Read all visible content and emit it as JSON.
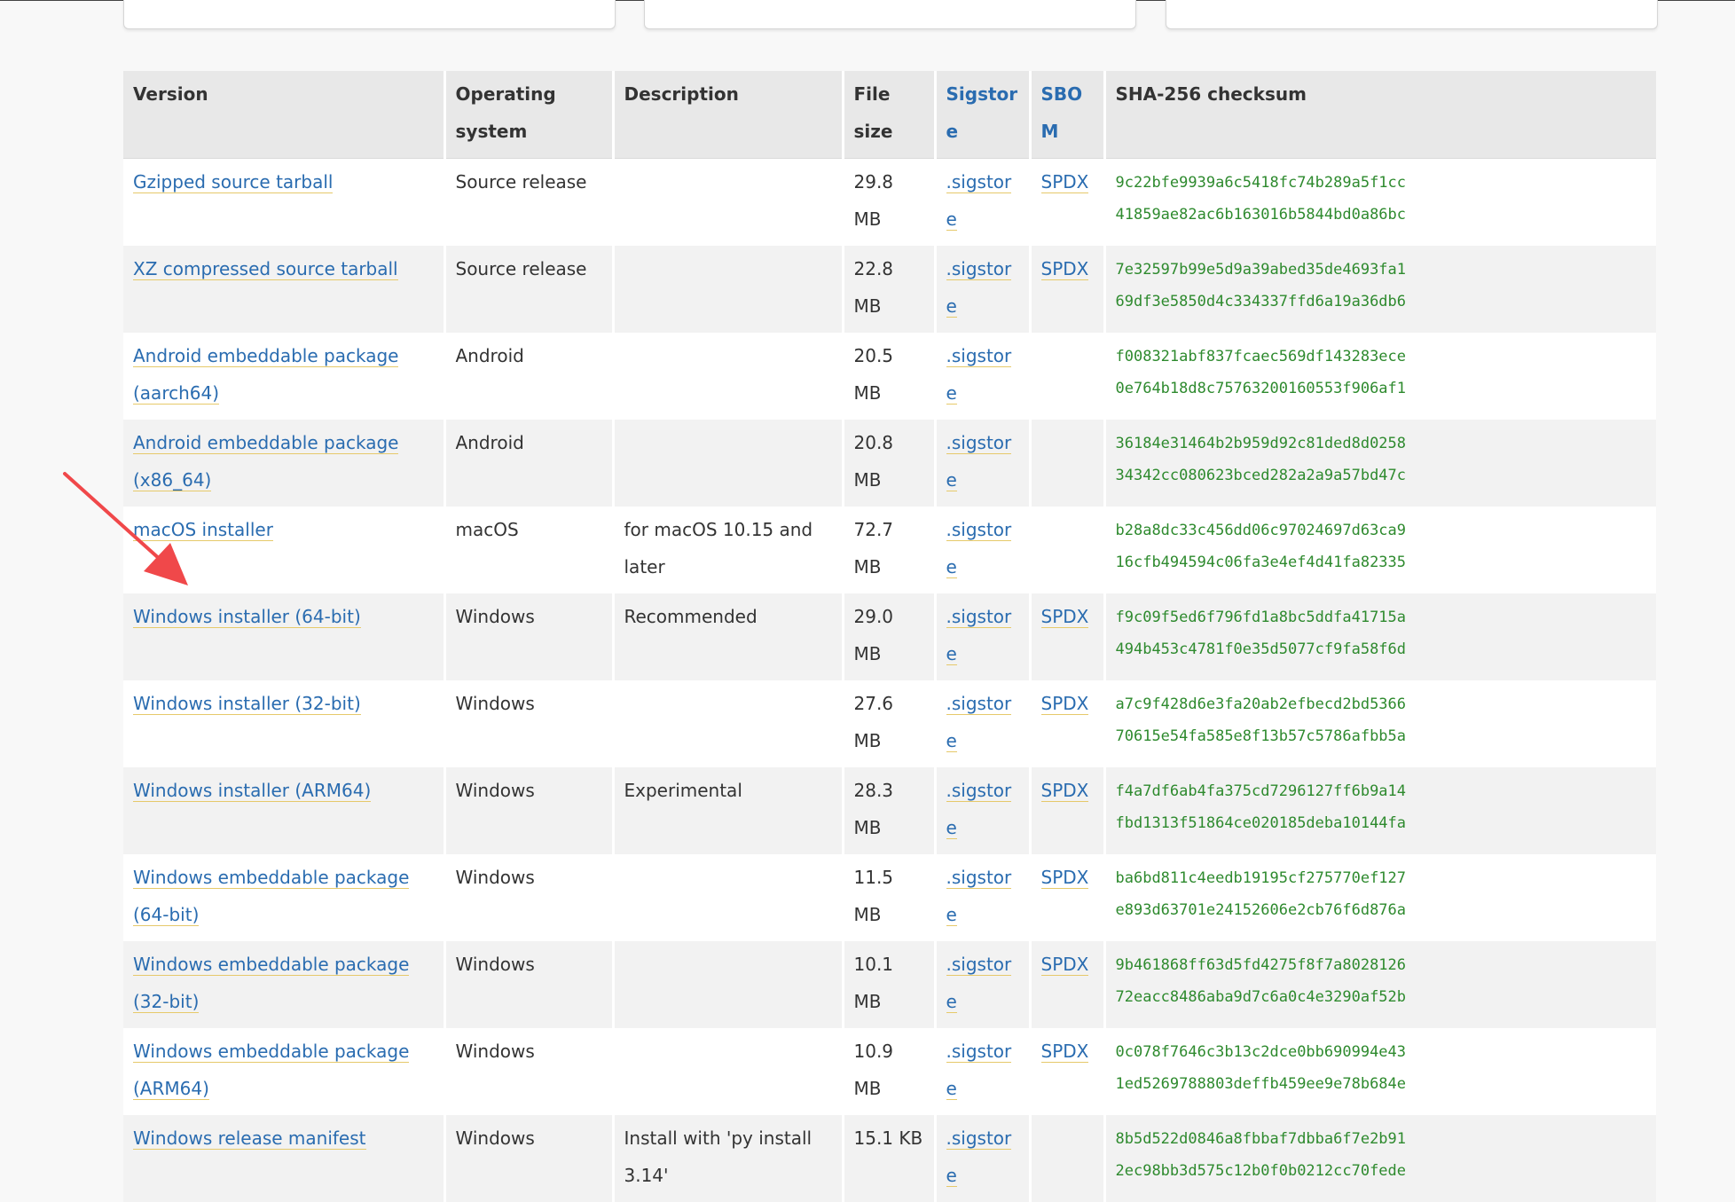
{
  "colors": {
    "link": "#2a6cb0",
    "link_underline": "#e6c96a",
    "checksum": "#2e8a2e",
    "arrow": "#f0484a",
    "header_bg": "#e8e8e8"
  },
  "table": {
    "headers": {
      "version": "Version",
      "os": "Operating system",
      "description": "Description",
      "size": "File size",
      "sigstore": "Sigstore",
      "sbom": "SBOM",
      "sha": "SHA-256 checksum"
    },
    "rows": [
      {
        "version": "Gzipped source tarball",
        "os": "Source release",
        "description": "",
        "size": "29.8 MB",
        "sigstore": ".sigstore",
        "sbom": "SPDX",
        "sha1": "9c22bfe9939a6c5418fc74b289a5f1cc",
        "sha2": "41859ae82ac6b163016b5844bd0a86bc"
      },
      {
        "version": "XZ compressed source tarball",
        "os": "Source release",
        "description": "",
        "size": "22.8 MB",
        "sigstore": ".sigstore",
        "sbom": "SPDX",
        "sha1": "7e32597b99e5d9a39abed35de4693fa1",
        "sha2": "69df3e5850d4c334337ffd6a19a36db6"
      },
      {
        "version": "Android embeddable package (aarch64)",
        "os": "Android",
        "description": "",
        "size": "20.5 MB",
        "sigstore": ".sigstore",
        "sbom": "",
        "sha1": "f008321abf837fcaec569df143283ece",
        "sha2": "0e764b18d8c75763200160553f906af1"
      },
      {
        "version": "Android embeddable package (x86_64)",
        "os": "Android",
        "description": "",
        "size": "20.8 MB",
        "sigstore": ".sigstore",
        "sbom": "",
        "sha1": "36184e31464b2b959d92c81ded8d0258",
        "sha2": "34342cc080623bced282a2a9a57bd47c"
      },
      {
        "version": "macOS installer",
        "os": "macOS",
        "description": "for macOS 10.15 and later",
        "size": "72.7 MB",
        "sigstore": ".sigstore",
        "sbom": "",
        "sha1": "b28a8dc33c456dd06c97024697d63ca9",
        "sha2": "16cfb494594c06fa3e4ef4d41fa82335"
      },
      {
        "version": "Windows installer (64-bit)",
        "os": "Windows",
        "description": "Recommended",
        "size": "29.0 MB",
        "sigstore": ".sigstore",
        "sbom": "SPDX",
        "sha1": "f9c09f5ed6f796fd1a8bc5ddfa41715a",
        "sha2": "494b453c4781f0e35d5077cf9fa58f6d"
      },
      {
        "version": "Windows installer (32-bit)",
        "os": "Windows",
        "description": "",
        "size": "27.6 MB",
        "sigstore": ".sigstore",
        "sbom": "SPDX",
        "sha1": "a7c9f428d6e3fa20ab2efbecd2bd5366",
        "sha2": "70615e54fa585e8f13b57c5786afbb5a"
      },
      {
        "version": "Windows installer (ARM64)",
        "os": "Windows",
        "description": "Experimental",
        "size": "28.3 MB",
        "sigstore": ".sigstore",
        "sbom": "SPDX",
        "sha1": "f4a7df6ab4fa375cd7296127ff6b9a14",
        "sha2": "fbd1313f51864ce020185deba10144fa"
      },
      {
        "version": "Windows embeddable package (64-bit)",
        "os": "Windows",
        "description": "",
        "size": "11.5 MB",
        "sigstore": ".sigstore",
        "sbom": "SPDX",
        "sha1": "ba6bd811c4eedb19195cf275770ef127",
        "sha2": "e893d63701e24152606e2cb76f6d876a"
      },
      {
        "version": "Windows embeddable package (32-bit)",
        "os": "Windows",
        "description": "",
        "size": "10.1 MB",
        "sigstore": ".sigstore",
        "sbom": "SPDX",
        "sha1": "9b461868ff63d5fd4275f8f7a8028126",
        "sha2": "72eacc8486aba9d7c6a0c4e3290af52b"
      },
      {
        "version": "Windows embeddable package (ARM64)",
        "os": "Windows",
        "description": "",
        "size": "10.9 MB",
        "sigstore": ".sigstore",
        "sbom": "SPDX",
        "sha1": "0c078f7646c3b13c2dce0bb690994e43",
        "sha2": "1ed5269788803deffb459ee9e78b684e"
      },
      {
        "version": "Windows release manifest",
        "os": "Windows",
        "description": "Install with 'py install 3.14'",
        "size": "15.1 KB",
        "sigstore": ".sigstore",
        "sbom": "",
        "sha1": "8b5d522d0846a8fbbaf7dbba6f7e2b91",
        "sha2": "2ec98bb3d575c12b0f0b0212cc70fede"
      }
    ]
  }
}
